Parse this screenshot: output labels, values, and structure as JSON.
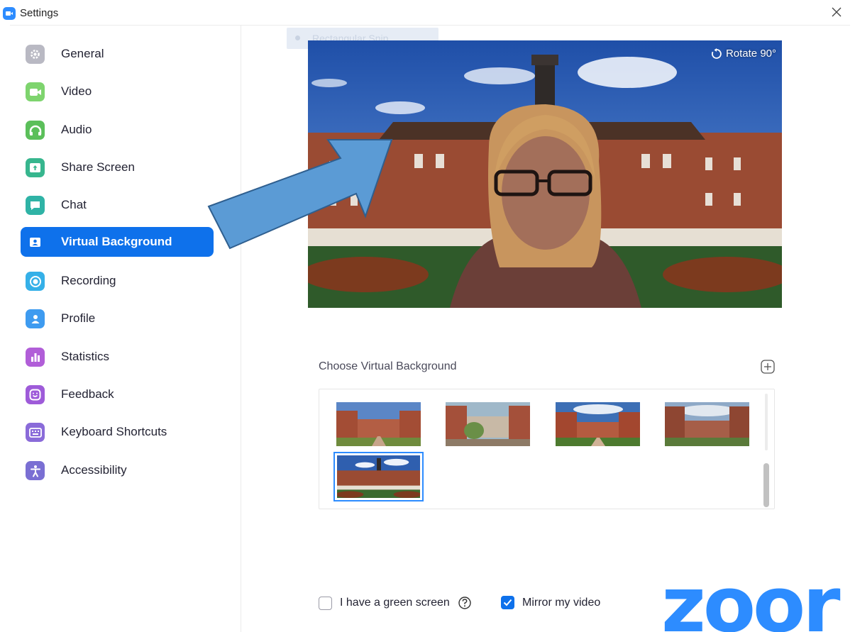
{
  "window": {
    "title": "Settings"
  },
  "sidebar": {
    "items": [
      {
        "label": "General",
        "icon": "gear-icon",
        "color": "#B9B9C3",
        "active": false
      },
      {
        "label": "Video",
        "icon": "video-camera-icon",
        "color": "#7ED46E",
        "active": false
      },
      {
        "label": "Audio",
        "icon": "headphones-icon",
        "color": "#5BBF5A",
        "active": false
      },
      {
        "label": "Share Screen",
        "icon": "share-screen-icon",
        "color": "#37B68E",
        "active": false
      },
      {
        "label": "Chat",
        "icon": "chat-bubble-icon",
        "color": "#2FB3A6",
        "active": false
      },
      {
        "label": "Virtual Background",
        "icon": "portrait-icon",
        "color": "#FFFFFF",
        "active": true
      },
      {
        "label": "Recording",
        "icon": "record-icon",
        "color": "#35B0E8",
        "active": false
      },
      {
        "label": "Profile",
        "icon": "person-icon",
        "color": "#3E9BF0",
        "active": false
      },
      {
        "label": "Statistics",
        "icon": "bar-chart-icon",
        "color": "#B15ED8",
        "active": false
      },
      {
        "label": "Feedback",
        "icon": "smile-icon",
        "color": "#9E5BD9",
        "active": false
      },
      {
        "label": "Keyboard Shortcuts",
        "icon": "keyboard-icon",
        "color": "#8A6BD9",
        "active": false
      },
      {
        "label": "Accessibility",
        "icon": "accessibility-icon",
        "color": "#7A6FD3",
        "active": false
      }
    ]
  },
  "main": {
    "ghost_chip_text": "Rectangular Snip",
    "rotate_label": "Rotate 90°",
    "choose_label": "Choose Virtual Background",
    "backgrounds_count_visible": 5,
    "selected_background_index": 4,
    "green_screen_label": "I have a green screen",
    "green_screen_checked": false,
    "mirror_label": "Mirror my video",
    "mirror_checked": true,
    "logo_text": "zoor"
  },
  "colors": {
    "accent": "#0E71EB",
    "brand": "#2D8CFF",
    "arrow_fill": "#5B9BD5",
    "arrow_stroke": "#2F5F8F"
  }
}
